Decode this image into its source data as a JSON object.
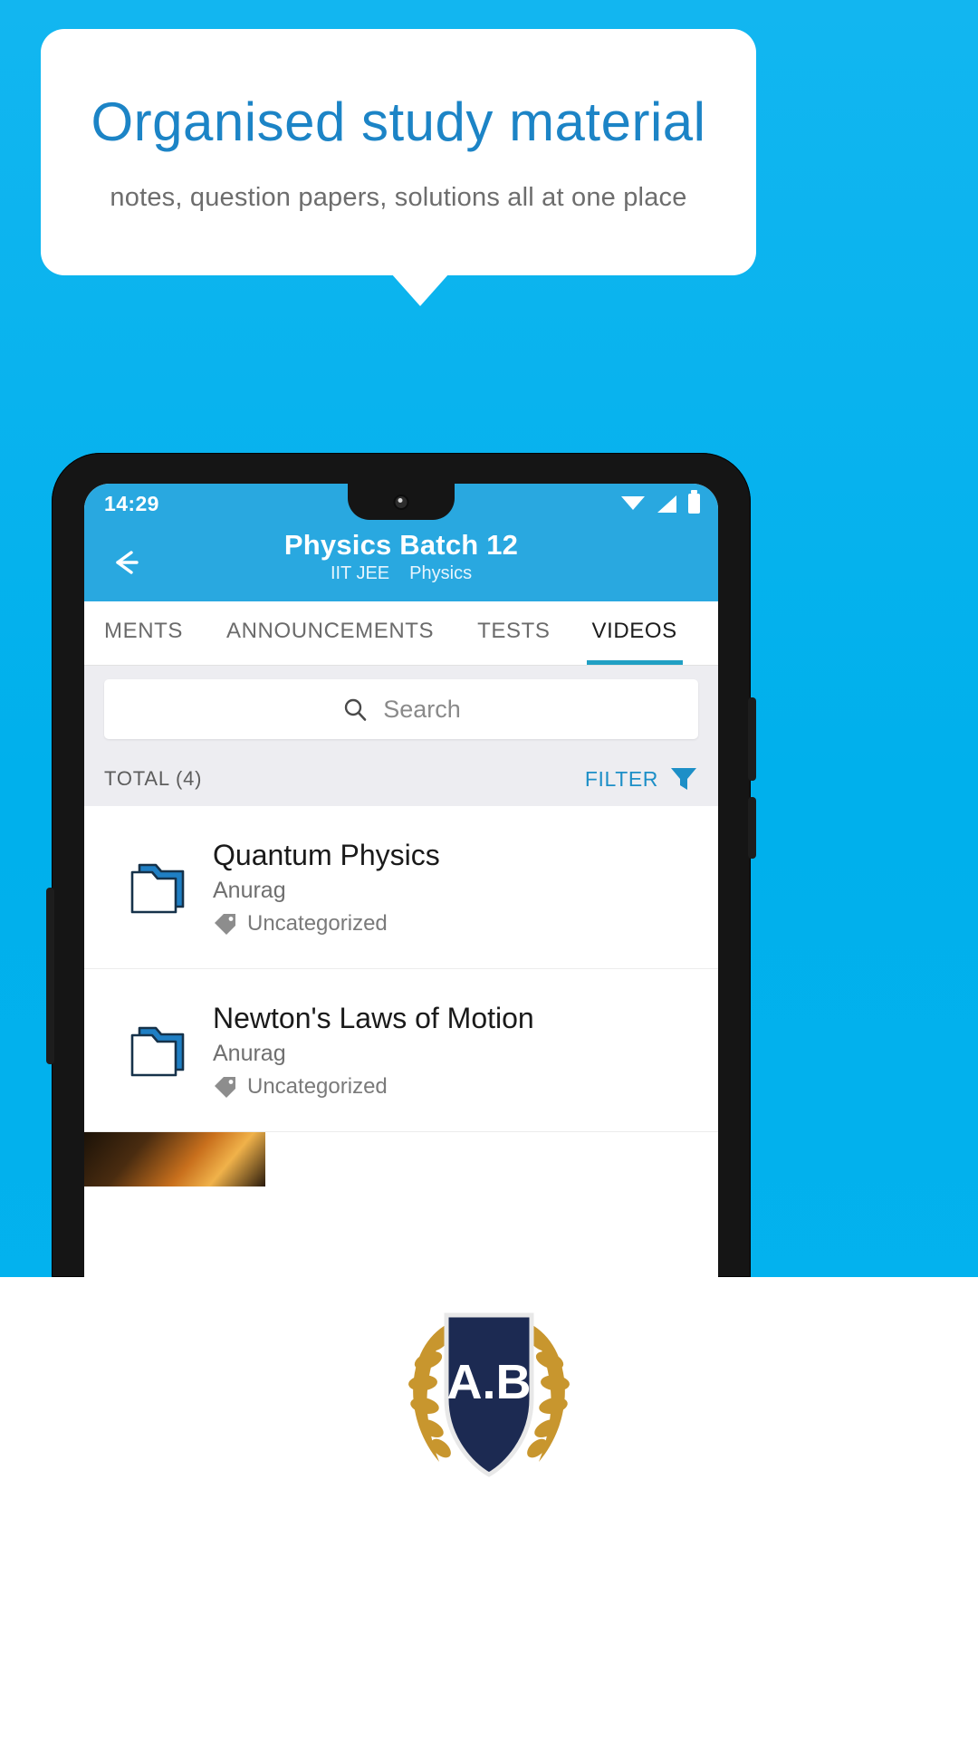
{
  "callout": {
    "title": "Organised study material",
    "subtitle": "notes, question papers, solutions all at one place"
  },
  "colors": {
    "background": "#00b3ee",
    "callout_title": "#1c84c6",
    "appbar": "#29a8e0",
    "tab_active_underline": "#21a0c4",
    "filter_link": "#1d8fc7",
    "folder_icon": "#1f7fc4",
    "badge_navy": "#1c2a52",
    "laurel_gold": "#c8962e"
  },
  "phone": {
    "status_bar": {
      "clock": "14:29",
      "icons": [
        "wifi-icon",
        "signal-icon",
        "battery-icon"
      ]
    },
    "app_bar": {
      "back_icon": "back-arrow-icon",
      "title": "Physics Batch 12",
      "subtitle_tags": [
        "IIT JEE",
        "Physics"
      ]
    },
    "tabs": [
      {
        "label": "MENTS",
        "active": false
      },
      {
        "label": "ANNOUNCEMENTS",
        "active": false
      },
      {
        "label": "TESTS",
        "active": false
      },
      {
        "label": "VIDEOS",
        "active": true
      }
    ],
    "search": {
      "icon": "search-icon",
      "placeholder": "Search",
      "value": ""
    },
    "list_header": {
      "total_label": "TOTAL (4)",
      "filter_label": "FILTER",
      "filter_icon": "funnel-icon"
    },
    "items": [
      {
        "icon": "folder-icon",
        "title": "Quantum Physics",
        "author": "Anurag",
        "tag_icon": "tag-icon",
        "tag": "Uncategorized"
      },
      {
        "icon": "folder-icon",
        "title": "Newton's Laws of Motion",
        "author": "Anurag",
        "tag_icon": "tag-icon",
        "tag": "Uncategorized"
      }
    ]
  },
  "badge": {
    "text": "A.B",
    "icon": "laurel-shield-badge"
  }
}
